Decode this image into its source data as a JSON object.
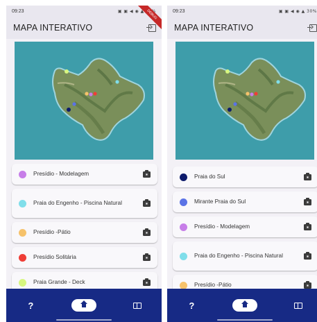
{
  "screens": [
    {
      "status": {
        "time": "09:23",
        "left_icons": "▣ ⚙",
        "right_icons": "▣ ▣ ◀ ◉ ▲ 30%"
      },
      "appbar": {
        "title": "MAPA INTERATIVO"
      },
      "ribbon": "DEBUG",
      "items": [
        {
          "label": "Presídio - Modelagem",
          "color": "#c77ee8"
        },
        {
          "label": "Praia do Engenho - Piscina Natural",
          "color": "#80deea"
        },
        {
          "label": "Presídio -Pátio",
          "color": "#f6c26b"
        },
        {
          "label": "Presídio Solitária",
          "color": "#ef3e36"
        },
        {
          "label": "Praia Grande - Deck",
          "color": "#d7f780"
        }
      ],
      "nav": {
        "help": "?",
        "home": "home-icon",
        "book": "book-icon"
      }
    },
    {
      "status": {
        "time": "09:23",
        "left_icons": "▣ ⚙",
        "right_icons": "▣ ▣ ◀ ◉ ▲ 30%"
      },
      "appbar": {
        "title": "MAPA INTERATIVO"
      },
      "items": [
        {
          "label": "Praia do Sul",
          "color": "#0d1b6b"
        },
        {
          "label": "Mirante Praia do Sul",
          "color": "#5b73e6"
        },
        {
          "label": "Presídio - Modelagem",
          "color": "#c77ee8"
        },
        {
          "label": "Praia do Engenho - Piscina Natural",
          "color": "#80deea"
        },
        {
          "label": "Presídio -Pátio",
          "color": "#f6c26b"
        }
      ],
      "nav": {
        "help": "?",
        "home": "home-icon",
        "book": "book-icon"
      }
    }
  ],
  "colors": {
    "nav_bg": "#172a85",
    "ocean": "#3e9daa",
    "appbar_bg": "#e9e7ef"
  }
}
